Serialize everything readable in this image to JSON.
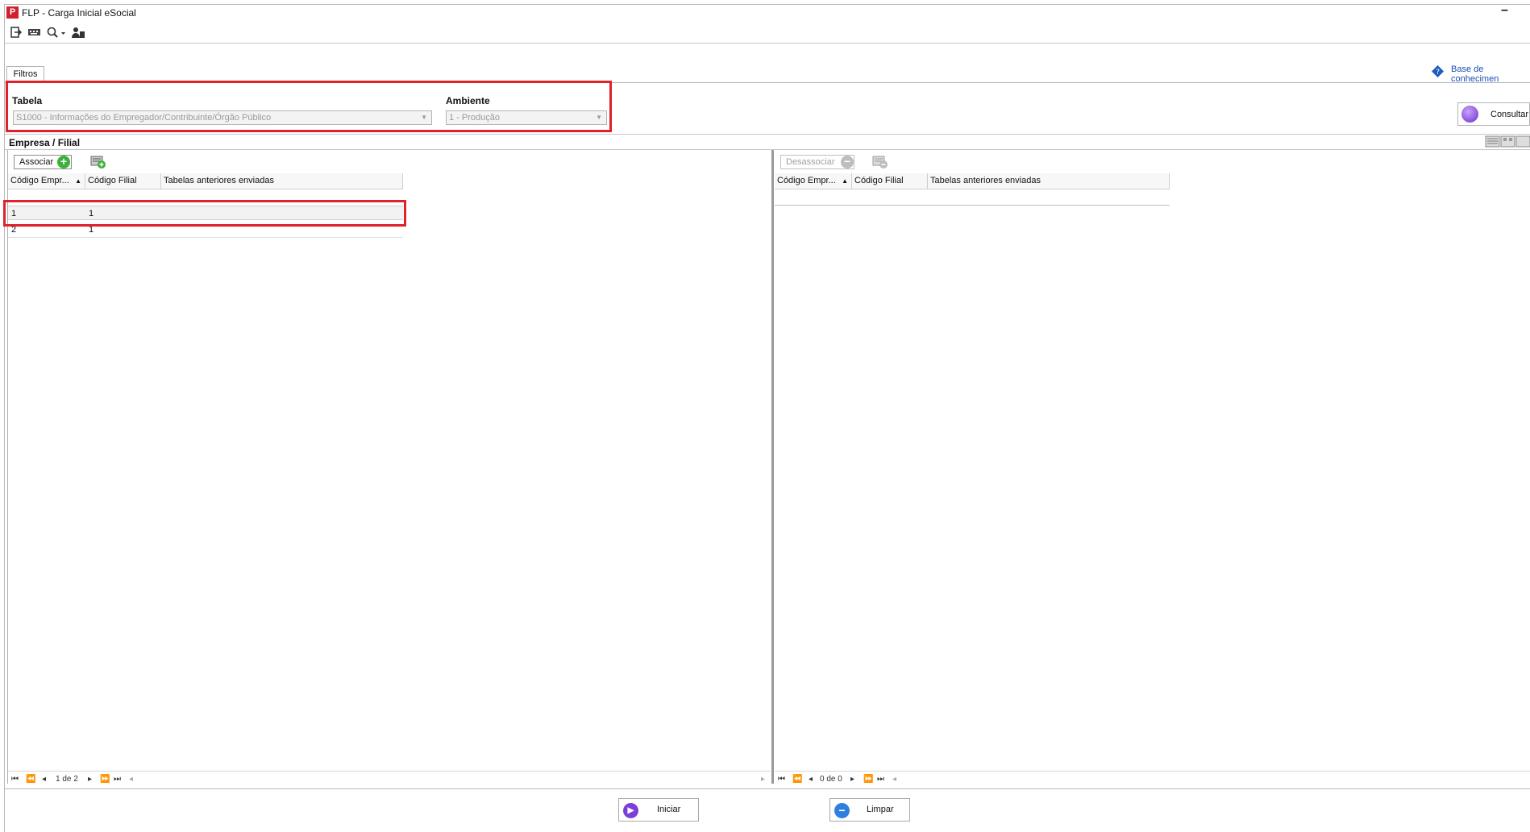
{
  "window": {
    "title": "FLP - Carga Inicial eSocial",
    "minimize_glyph": "–"
  },
  "toolbar": {
    "icons": [
      "exit-icon",
      "keyboard-icon",
      "search-dropdown-icon",
      "user-icon"
    ]
  },
  "tabs": {
    "filters_label": "Filtros"
  },
  "help": {
    "knowledge_base_label": "Base de conhecimen"
  },
  "filters": {
    "tabela_label": "Tabela",
    "tabela_value": "S1000 - Informações do Empregador/Contribuinte/Órgão Público",
    "ambiente_label": "Ambiente",
    "ambiente_value": "1 - Produção",
    "consultar_label": "Consultar"
  },
  "section": {
    "title": "Empresa / Filial"
  },
  "left_panel": {
    "associate_label": "Associar",
    "columns": [
      "Código Empr...",
      "Código Filial",
      "Tabelas anteriores enviadas"
    ],
    "rows": [
      {
        "empresa": "1",
        "filial": "1",
        "tabelas": ""
      },
      {
        "empresa": "2",
        "filial": "1",
        "tabelas": ""
      }
    ],
    "pager_text": "1 de 2"
  },
  "right_panel": {
    "disassociate_label": "Desassociar",
    "columns": [
      "Código Empr...",
      "Código Filial",
      "Tabelas anteriores enviadas"
    ],
    "rows": [],
    "pager_text": "0 de 0"
  },
  "actions": {
    "start_label": "Iniciar",
    "clear_label": "Limpar"
  },
  "colors": {
    "highlight": "#e0202a",
    "link": "#1a4fb3",
    "start_icon": "#7b3fd6",
    "clear_icon": "#2f7fe0",
    "add_icon": "#3bb13b"
  }
}
